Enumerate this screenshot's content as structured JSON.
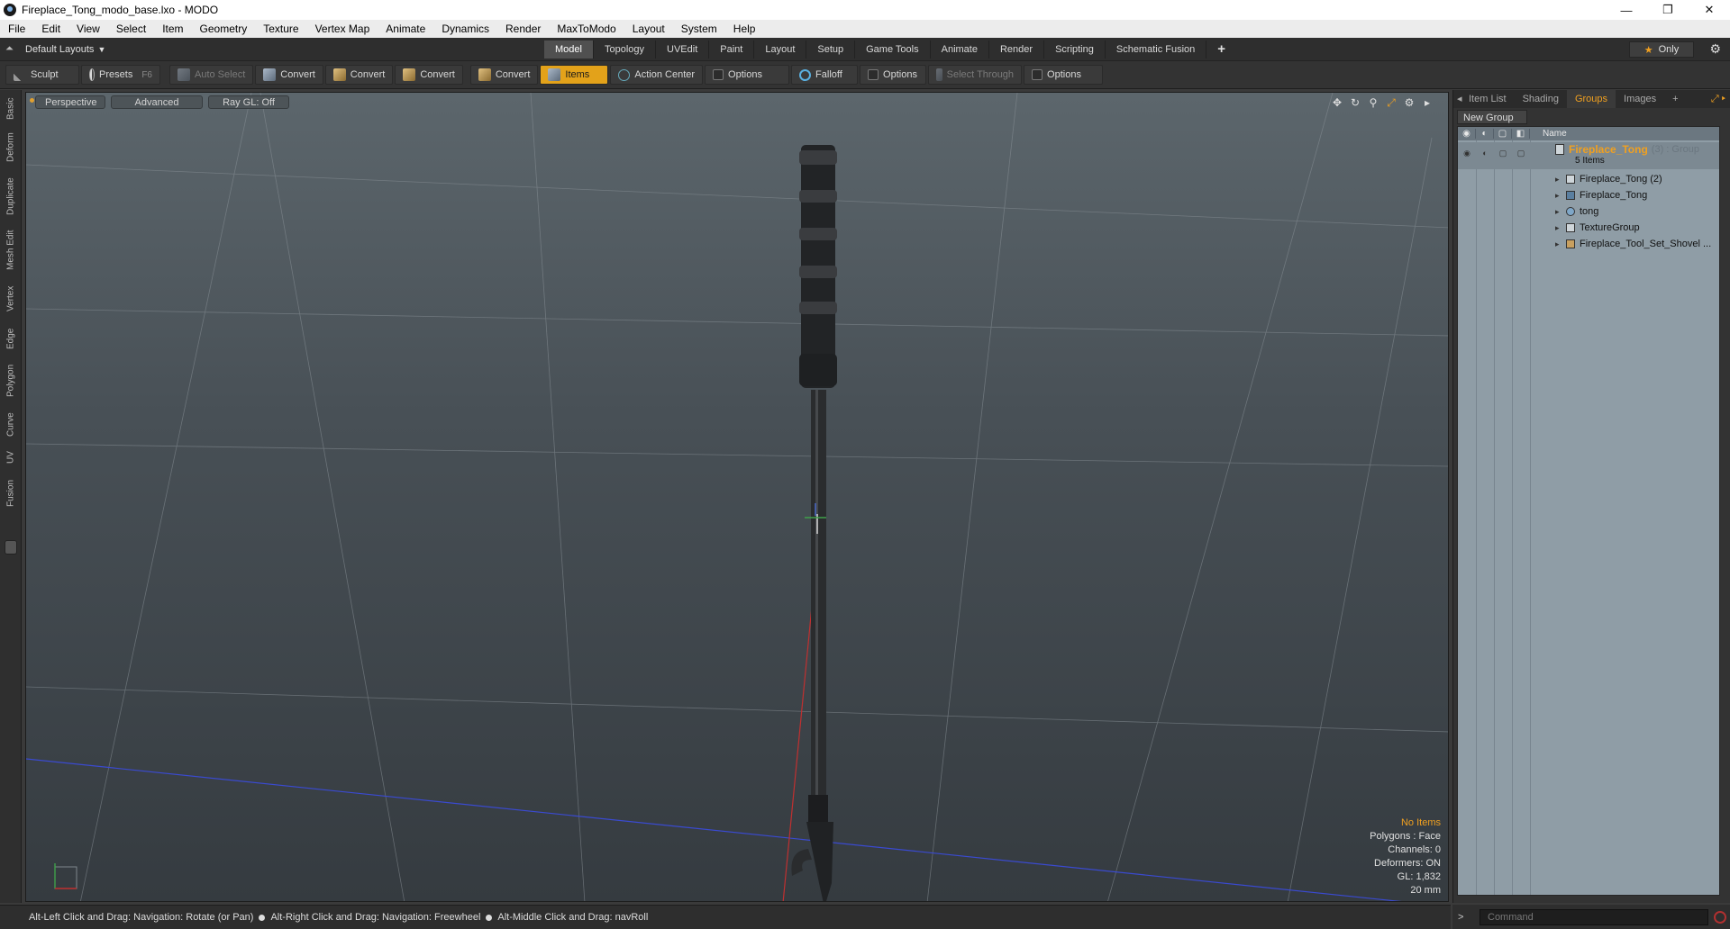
{
  "window": {
    "title": "Fireplace_Tong_modo_base.lxo - MODO",
    "controls": [
      "—",
      "❐",
      "✕"
    ]
  },
  "menu": [
    "File",
    "Edit",
    "View",
    "Select",
    "Item",
    "Geometry",
    "Texture",
    "Vertex Map",
    "Animate",
    "Dynamics",
    "Render",
    "MaxToModo",
    "Layout",
    "System",
    "Help"
  ],
  "layoutbar": {
    "layouts_label": "Default Layouts",
    "tabs": [
      "Model",
      "Topology",
      "UVEdit",
      "Paint",
      "Layout",
      "Setup",
      "Game Tools",
      "Animate",
      "Render",
      "Scripting",
      "Schematic Fusion"
    ],
    "active_tab": "Model",
    "add_tab": "+",
    "only_label": "Only"
  },
  "toolbar": {
    "sculpt": "Sculpt",
    "presets": "Presets",
    "presets_shortcut": "F6",
    "auto_select": "Auto Select",
    "convert_1": "Convert",
    "convert_2": "Convert",
    "convert_3": "Convert",
    "convert_4": "Convert",
    "items": "Items",
    "action_center": "Action Center",
    "options_1": "Options",
    "falloff": "Falloff",
    "options_2": "Options",
    "select_through": "Select Through",
    "options_3": "Options"
  },
  "left_tabs": [
    "Basic",
    "Deform",
    "Duplicate",
    "Mesh Edit",
    "Vertex",
    "Edge",
    "Polygon",
    "Curve",
    "UV",
    "Fusion"
  ],
  "viewport": {
    "perspective": "Perspective",
    "advanced": "Advanced",
    "raygl": "Ray GL: Off",
    "stats": {
      "items": "No Items",
      "polygons": "Polygons : Face",
      "channels": "Channels: 0",
      "deformers": "Deformers: ON",
      "gl": "GL: 1,832",
      "scale": "20 mm"
    }
  },
  "right_panel": {
    "tabs": [
      "Item List",
      "Shading",
      "Groups",
      "Images"
    ],
    "active_tab": "Groups",
    "add_tab": "+",
    "new_group": "New Group",
    "name_header": "Name",
    "group": {
      "name": "Fireplace_Tong",
      "suffix": "(3) : Group",
      "count": "5 Items"
    },
    "items": [
      {
        "name": "Fireplace_Tong (2)",
        "icon": "folder-icon"
      },
      {
        "name": "Fireplace_Tong",
        "icon": "mesh-icon"
      },
      {
        "name": "tong",
        "icon": "material-icon"
      },
      {
        "name": "TextureGroup",
        "icon": "folder-icon"
      },
      {
        "name": "Fireplace_Tool_Set_Shovel ...",
        "icon": "camera-icon"
      }
    ]
  },
  "statusbar": {
    "hint_1": "Alt-Left Click and Drag: Navigation: Rotate (or Pan)",
    "hint_2": "Alt-Right Click and Drag: Navigation: Freewheel",
    "hint_3": "Alt-Middle Click and Drag: navRoll"
  },
  "command": {
    "prompt": ">",
    "placeholder": "Command"
  },
  "colors": {
    "accent": "#f0a020",
    "items_button": "#e3a21a"
  }
}
